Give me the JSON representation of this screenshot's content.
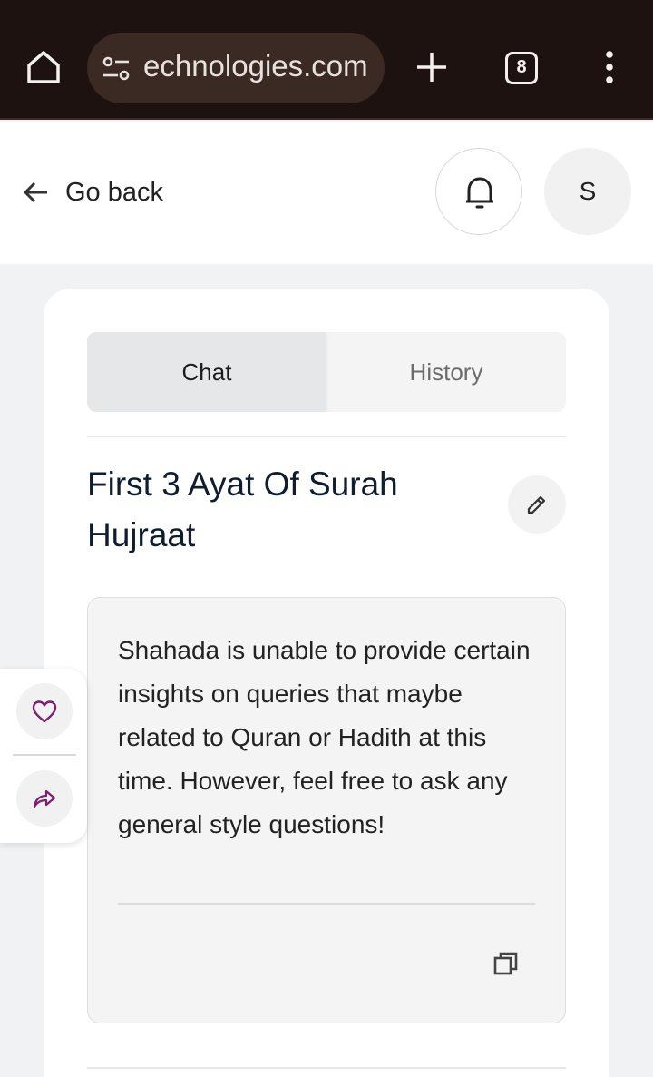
{
  "browser": {
    "url_text": "echnologies.com",
    "tab_count": "8"
  },
  "header": {
    "back_label": "Go back",
    "avatar_initial": "S"
  },
  "tabs": {
    "chat": "Chat",
    "history": "History",
    "active": "Chat"
  },
  "chat": {
    "title": "First 3 Ayat Of Surah Hujraat",
    "message": "Shahada is unable to provide certain insights on queries that maybe related to Quran or Hadith at this time. However, feel free to ask any general style questions!"
  },
  "icons": {
    "home": "home-icon",
    "site_settings": "tune-icon",
    "new_tab": "plus-icon",
    "tabs": "tab-count-icon",
    "menu": "more-vert-icon",
    "back": "arrow-left-icon",
    "notifications": "bell-icon",
    "edit": "pencil-icon",
    "copy": "copy-icon",
    "like": "heart-icon",
    "share": "share-icon"
  },
  "colors": {
    "browser_bar": "#1e1210",
    "url_pill": "#3b2a23",
    "accent_purple": "#7b1f6e",
    "title_text": "#0f1d2e"
  }
}
